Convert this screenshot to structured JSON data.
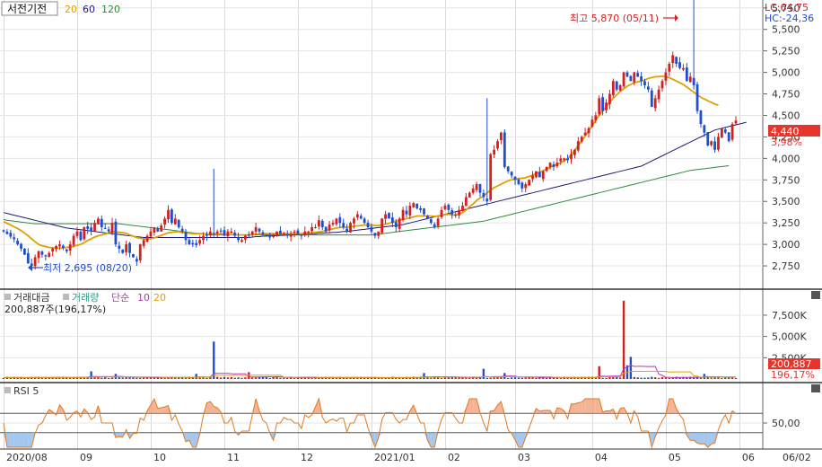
{
  "header": {
    "stock_name": "서전기전",
    "ma_labels": [
      "20",
      "60",
      "120"
    ],
    "lc_label": "LC:64,75",
    "hc_label": "HC:-24,36"
  },
  "price_panel": {
    "high_label": "최고 5,870 (05/11)",
    "low_label": "최저 2,695 (08/20)",
    "current_price": "4,440",
    "current_change": "3,98%"
  },
  "volume_panel": {
    "legend": [
      "거래대금",
      "거래량",
      "단순",
      "10",
      "20"
    ],
    "readout": "200,887주(196,17%)",
    "current_volume": "200,887",
    "current_ratio": "196,17%"
  },
  "rsi_panel": {
    "label": "RSI 5"
  },
  "x_axis": {
    "labels": [
      "2020/08",
      "09",
      "10",
      "11",
      "12",
      "2021/01",
      "02",
      "03",
      "04",
      "05",
      "06",
      "06/02"
    ]
  },
  "colors": {
    "up": "#d32020",
    "down": "#1f4fd1",
    "ma20": "#e0a000",
    "ma60": "#1a1a7a",
    "ma120": "#2f8a3c",
    "rsi": "#e07a20",
    "price_tag": "#e8342a"
  },
  "chart_data": [
    {
      "type": "candlestick",
      "ylim": [
        2500,
        5800
      ],
      "y_ticks": [
        "2,750",
        "3,000",
        "3,250",
        "3,500",
        "3,750",
        "4,000",
        "4,250",
        "4,500",
        "4,750",
        "5,000",
        "5,250",
        "5,500",
        "5,750"
      ],
      "x_months": [
        "2020/08",
        "09",
        "10",
        "11",
        "12",
        "2021/01",
        "02",
        "03",
        "04",
        "05",
        "06"
      ],
      "closes": [
        3150,
        3120,
        3090,
        3060,
        3000,
        2950,
        2880,
        2780,
        2750,
        2850,
        2920,
        2880,
        2860,
        2900,
        2950,
        2980,
        3000,
        2960,
        2920,
        3000,
        3100,
        3150,
        3050,
        3200,
        3180,
        3150,
        3250,
        3300,
        3200,
        3180,
        3150,
        3250,
        3000,
        2950,
        2900,
        3000,
        2900,
        2850,
        2800,
        3000,
        3050,
        3100,
        3150,
        3200,
        3150,
        3220,
        3300,
        3400,
        3250,
        3300,
        3200,
        3150,
        3050,
        3000,
        3000,
        2990,
        3050,
        3100,
        3100,
        3150,
        3120,
        3150,
        3150,
        3100,
        3150,
        3150,
        3100,
        3050,
        3050,
        3100,
        3100,
        3150,
        3200,
        3150,
        3120,
        3100,
        3080,
        3100,
        3150,
        3120,
        3130,
        3100,
        3120,
        3150,
        3120,
        3100,
        3150,
        3150,
        3200,
        3200,
        3280,
        3200,
        3150,
        3230,
        3250,
        3300,
        3250,
        3200,
        3150,
        3250,
        3300,
        3350,
        3300,
        3250,
        3200,
        3150,
        3100,
        3150,
        3300,
        3350,
        3300,
        3250,
        3200,
        3300,
        3400,
        3350,
        3450,
        3480,
        3420,
        3400,
        3350,
        3300,
        3250,
        3200,
        3300,
        3400,
        3450,
        3400,
        3350,
        3350,
        3400,
        3450,
        3550,
        3600,
        3650,
        3700,
        3600,
        3550,
        3500,
        4050,
        4100,
        4200,
        4300,
        3900,
        3850,
        3800,
        3750,
        3700,
        3650,
        3700,
        3750,
        3800,
        3850,
        3780,
        3850,
        3900,
        3950,
        3900,
        3950,
        4000,
        4000,
        3980,
        4050,
        4100,
        4200,
        4250,
        4300,
        4350,
        4450,
        4500,
        4700,
        4550,
        4650,
        4750,
        4900,
        4800,
        4850,
        5000,
        4950,
        4900,
        5000,
        4950,
        4900,
        4850,
        4800,
        4600,
        4700,
        4800,
        4900,
        5000,
        5100,
        5200,
        5100,
        5050,
        5050,
        4900,
        4950,
        4850,
        4550,
        4400,
        4300,
        4150,
        4200,
        4100,
        4250,
        4350,
        4300,
        4200,
        4400,
        4440
      ],
      "ma20": [
        3265,
        3245,
        3225,
        3205,
        3185,
        3160,
        3130,
        3100,
        3065,
        3030,
        3000,
        2985,
        2975,
        2965,
        2960,
        2955,
        2955,
        2960,
        2965,
        2970,
        2980,
        2990,
        3000,
        3020,
        3045,
        3065,
        3085,
        3100,
        3110,
        3120,
        3135,
        3145,
        3145,
        3140,
        3135,
        3130,
        3110,
        3095,
        3080,
        3070,
        3065,
        3060,
        3065,
        3075,
        3090,
        3105,
        3120,
        3135,
        3140,
        3145,
        3150,
        3140,
        3135,
        3130,
        3125,
        3125,
        3125,
        3125,
        3120,
        3120,
        3120,
        3120,
        3120,
        3115,
        3115,
        3115,
        3115,
        3110,
        3110,
        3110,
        3110,
        3115,
        3120,
        3120,
        3125,
        3125,
        3125,
        3125,
        3125,
        3125,
        3125,
        3125,
        3125,
        3125,
        3125,
        3125,
        3130,
        3130,
        3135,
        3140,
        3145,
        3150,
        3160,
        3170,
        3180,
        3190,
        3195,
        3200,
        3200,
        3205,
        3210,
        3215,
        3220,
        3225,
        3225,
        3225,
        3220,
        3220,
        3225,
        3235,
        3245,
        3260,
        3270,
        3280,
        3290,
        3300,
        3310,
        3320,
        3330,
        3330,
        3330,
        3330,
        3330,
        3325,
        3330,
        3340,
        3345,
        3350,
        3345,
        3340,
        3350,
        3370,
        3400,
        3440,
        3470,
        3510,
        3540,
        3560,
        3600,
        3630,
        3660,
        3680,
        3700,
        3720,
        3740,
        3750,
        3760,
        3765,
        3770,
        3775,
        3790,
        3805,
        3825,
        3840,
        3855,
        3875,
        3895,
        3915,
        3930,
        3950,
        3970,
        4000,
        4040,
        4090,
        4150,
        4200,
        4260,
        4320,
        4380,
        4440,
        4500,
        4550,
        4600,
        4650,
        4700,
        4740,
        4780,
        4810,
        4840,
        4860,
        4880,
        4890,
        4900,
        4910,
        4930,
        4940,
        4950,
        4950,
        4955,
        4950,
        4940,
        4920,
        4900,
        4880,
        4860,
        4830,
        4800,
        4770,
        4740,
        4710,
        4690,
        4670,
        4650,
        4630,
        4620
      ],
      "ma60": [
        3370,
        3360,
        3350,
        3340,
        3330,
        3320,
        3310,
        3300,
        3290,
        3280,
        3270,
        3260,
        3250,
        3240,
        3230,
        3220,
        3210,
        3200,
        3190,
        3185,
        3180,
        3175,
        3170,
        3165,
        3160,
        3155,
        3150,
        3145,
        3140,
        3135,
        3130,
        3125,
        3120,
        3115,
        3110,
        3105,
        3100,
        3095,
        3090,
        3085,
        3080,
        3080,
        3080,
        3080,
        3080,
        3080,
        3080,
        3080,
        3080,
        3080,
        3080,
        3080,
        3080,
        3080,
        3080,
        3080,
        3080,
        3080,
        3080,
        3080,
        3080,
        3080,
        3080,
        3080,
        3080,
        3080,
        3080,
        3080,
        3080,
        3080,
        3080,
        3085,
        3090,
        3090,
        3095,
        3095,
        3100,
        3100,
        3100,
        3105,
        3105,
        3110,
        3110,
        3110,
        3115,
        3115,
        3120,
        3120,
        3125,
        3125,
        3130,
        3130,
        3135,
        3135,
        3140,
        3140,
        3145,
        3150,
        3150,
        3155,
        3160,
        3165,
        3170,
        3175,
        3180,
        3185,
        3190,
        3195,
        3200,
        3205,
        3210,
        3215,
        3220,
        3225,
        3230,
        3240,
        3250,
        3260,
        3270,
        3280,
        3290,
        3300,
        3310,
        3320,
        3330,
        3340,
        3350,
        3360,
        3370,
        3380,
        3390,
        3400,
        3410,
        3420,
        3430,
        3440,
        3450,
        3460,
        3470,
        3480,
        3490,
        3500,
        3510,
        3520,
        3530,
        3540,
        3550,
        3560,
        3570,
        3580,
        3590,
        3600,
        3610,
        3620,
        3630,
        3640,
        3650,
        3660,
        3670,
        3680,
        3690,
        3700,
        3710,
        3720,
        3730,
        3740,
        3750,
        3760,
        3770,
        3780,
        3790,
        3800,
        3810,
        3820,
        3830,
        3840,
        3850,
        3860,
        3870,
        3880,
        3890,
        3900,
        3910,
        3930,
        3950,
        3970,
        3990,
        4010,
        4030,
        4050,
        4070,
        4090,
        4110,
        4130,
        4150,
        4170,
        4190,
        4210,
        4230,
        4250,
        4270,
        4290,
        4310,
        4330,
        4340,
        4350,
        4360,
        4370,
        4380,
        4390,
        4400,
        4410,
        4420
      ],
      "ma120": [
        3290,
        3280,
        3275,
        3270,
        3265,
        3260,
        3255,
        3250,
        3245,
        3240,
        3240,
        3240,
        3240,
        3240,
        3240,
        3240,
        3240,
        3240,
        3240,
        3240,
        3240,
        3240,
        3240,
        3240,
        3240,
        3240,
        3240,
        3240,
        3240,
        3240,
        3240,
        3240,
        3240,
        3240,
        3235,
        3230,
        3225,
        3220,
        3215,
        3210,
        3205,
        3200,
        3195,
        3190,
        3185,
        3180,
        3175,
        3170,
        3165,
        3160,
        3155,
        3150,
        3145,
        3140,
        3135,
        3130,
        3125,
        3120,
        3115,
        3110,
        3110,
        3110,
        3110,
        3110,
        3110,
        3110,
        3110,
        3110,
        3110,
        3110,
        3110,
        3110,
        3110,
        3110,
        3110,
        3110,
        3110,
        3110,
        3110,
        3110,
        3110,
        3110,
        3110,
        3110,
        3110,
        3110,
        3110,
        3110,
        3110,
        3110,
        3110,
        3110,
        3110,
        3110,
        3110,
        3110,
        3110,
        3110,
        3110,
        3110,
        3110,
        3110,
        3110,
        3110,
        3110,
        3110,
        3115,
        3120,
        3125,
        3130,
        3135,
        3140,
        3145,
        3150,
        3155,
        3160,
        3165,
        3170,
        3175,
        3180,
        3185,
        3190,
        3195,
        3200,
        3205,
        3210,
        3215,
        3220,
        3225,
        3230,
        3235,
        3240,
        3245,
        3250,
        3255,
        3260,
        3265,
        3270,
        3280,
        3290,
        3300,
        3310,
        3320,
        3330,
        3340,
        3350,
        3360,
        3370,
        3380,
        3390,
        3400,
        3410,
        3420,
        3430,
        3440,
        3450,
        3460,
        3470,
        3480,
        3490,
        3500,
        3510,
        3520,
        3530,
        3540,
        3550,
        3560,
        3570,
        3580,
        3590,
        3600,
        3610,
        3620,
        3630,
        3640,
        3650,
        3660,
        3670,
        3680,
        3690,
        3700,
        3710,
        3720,
        3730,
        3740,
        3750,
        3760,
        3770,
        3780,
        3790,
        3800,
        3810,
        3820,
        3830,
        3840,
        3850,
        3860,
        3865,
        3870,
        3875,
        3880,
        3885,
        3890,
        3895,
        3900,
        3905,
        3910,
        3915
      ]
    },
    {
      "type": "bar",
      "series_name": "거래량",
      "ylim": [
        0,
        9500
      ],
      "y_ticks": [
        "2,500K",
        "5,000K",
        "7,500K"
      ],
      "spikes": [
        {
          "index": 25,
          "value": 900
        },
        {
          "index": 32,
          "value": 600
        },
        {
          "index": 55,
          "value": 600
        },
        {
          "index": 60,
          "value": 4400
        },
        {
          "index": 70,
          "value": 800
        },
        {
          "index": 120,
          "value": 700
        },
        {
          "index": 137,
          "value": 1200
        },
        {
          "index": 143,
          "value": 700
        },
        {
          "index": 170,
          "value": 1500
        },
        {
          "index": 177,
          "value": 9200
        },
        {
          "index": 178,
          "value": 1600
        },
        {
          "index": 179,
          "value": 2600
        },
        {
          "index": 200,
          "value": 600
        },
        {
          "index": 214,
          "value": 2200
        },
        {
          "index": 224,
          "value": 1100
        },
        {
          "index": 240,
          "value": 1000
        }
      ],
      "baseline_value": 180
    },
    {
      "type": "line",
      "series_name": "RSI 5",
      "ylim": [
        0,
        100
      ],
      "y_ticks": [
        "50,00"
      ],
      "upper_band": 70,
      "lower_band": 30
    }
  ]
}
